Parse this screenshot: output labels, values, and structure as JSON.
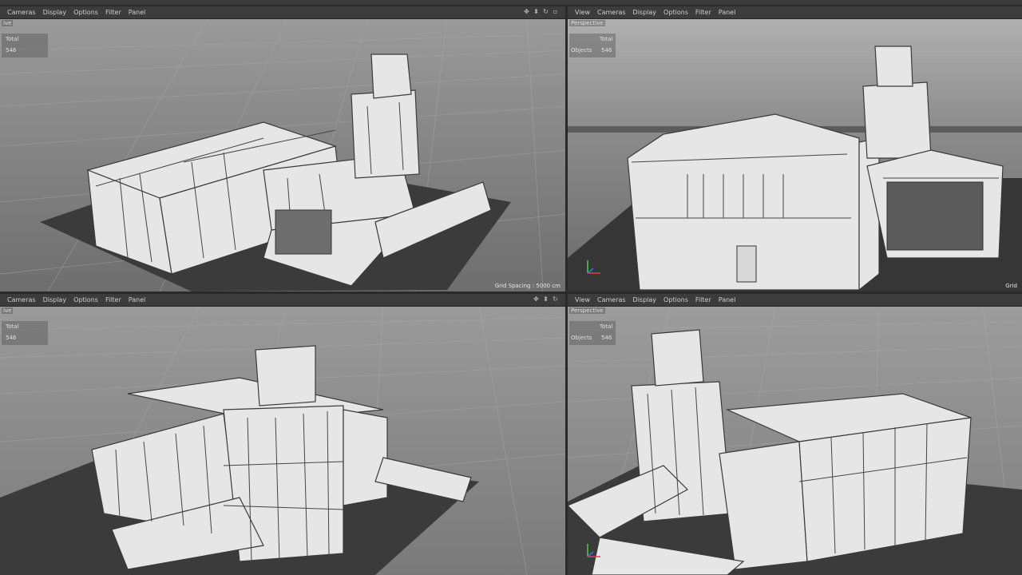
{
  "viewports": {
    "tl": {
      "menu": [
        "Cameras",
        "Display",
        "Options",
        "Filter",
        "Panel"
      ],
      "camera": "ive",
      "hud_total": "Total",
      "hud_objects_value": "546",
      "grid_spacing": "Grid Spacing : 5000 cm"
    },
    "tr": {
      "menu": [
        "View",
        "Cameras",
        "Display",
        "Options",
        "Filter",
        "Panel"
      ],
      "camera": "Perspective",
      "hud_total": "Total",
      "hud_objects_label": "Objects",
      "hud_objects_value": "546",
      "grid_spacing": "Grid"
    },
    "bl": {
      "menu": [
        "Cameras",
        "Display",
        "Options",
        "Filter",
        "Panel"
      ],
      "camera": "ive",
      "hud_total": "Total",
      "hud_objects_value": "546"
    },
    "br": {
      "menu": [
        "View",
        "Cameras",
        "Display",
        "Options",
        "Filter",
        "Panel"
      ],
      "camera": "Perspective",
      "hud_total": "Total",
      "hud_objects_label": "Objects",
      "hud_objects_value": "546"
    }
  },
  "colors": {
    "background": "#8a8a8a",
    "ground_plate": "#3b3b3b",
    "model_fill": "#e6e6e6",
    "model_edge": "#3a3a3a",
    "menubar": "#3c3c3c"
  },
  "icons": [
    "move-icon",
    "zoom-icon",
    "rotate-icon",
    "maximize-icon"
  ]
}
